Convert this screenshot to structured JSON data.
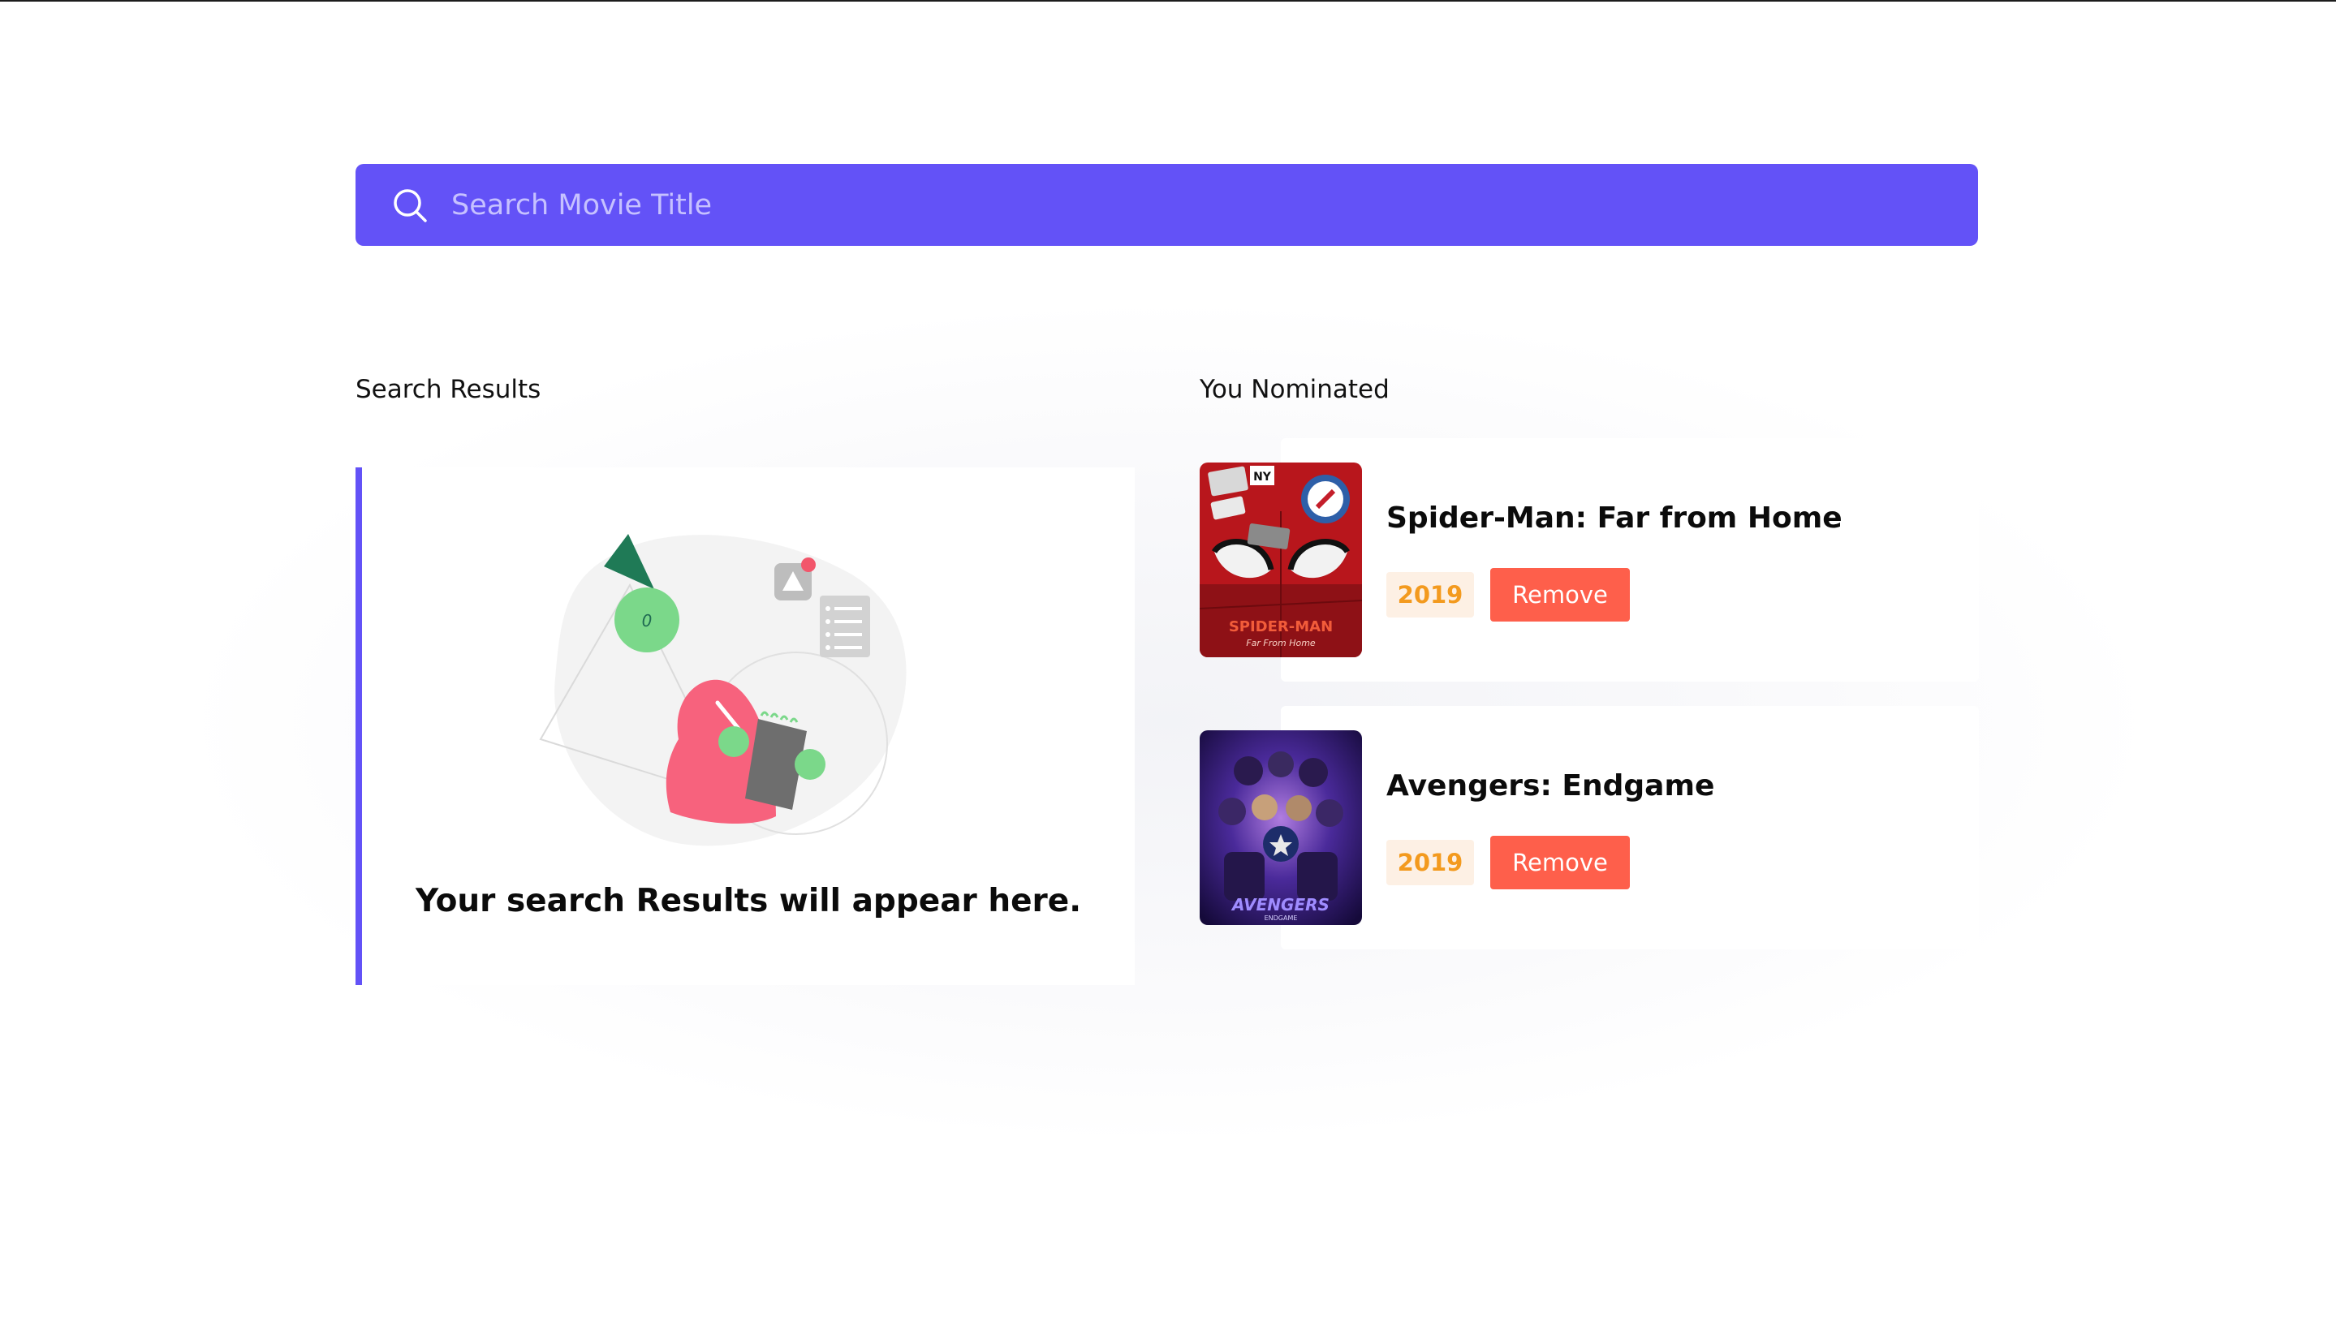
{
  "search": {
    "placeholder": "Search Movie Title",
    "icon": "search-icon"
  },
  "sections": {
    "results_heading": "Search Results",
    "nominated_heading": "You Nominated"
  },
  "results": {
    "empty_message": "Your search Results will appear here.",
    "illustration_icon": "empty-search-illustration"
  },
  "nominations": [
    {
      "title": "Spider-Man: Far from Home",
      "year": "2019",
      "remove_label": "Remove",
      "poster_icon": "spiderman-poster"
    },
    {
      "title": "Avengers: Endgame",
      "year": "2019",
      "remove_label": "Remove",
      "poster_icon": "avengers-poster"
    }
  ],
  "colors": {
    "accent": "#6352f7",
    "remove": "#fe5f4b",
    "year_text": "#f39a1e",
    "year_bg": "#fdf0e4"
  }
}
